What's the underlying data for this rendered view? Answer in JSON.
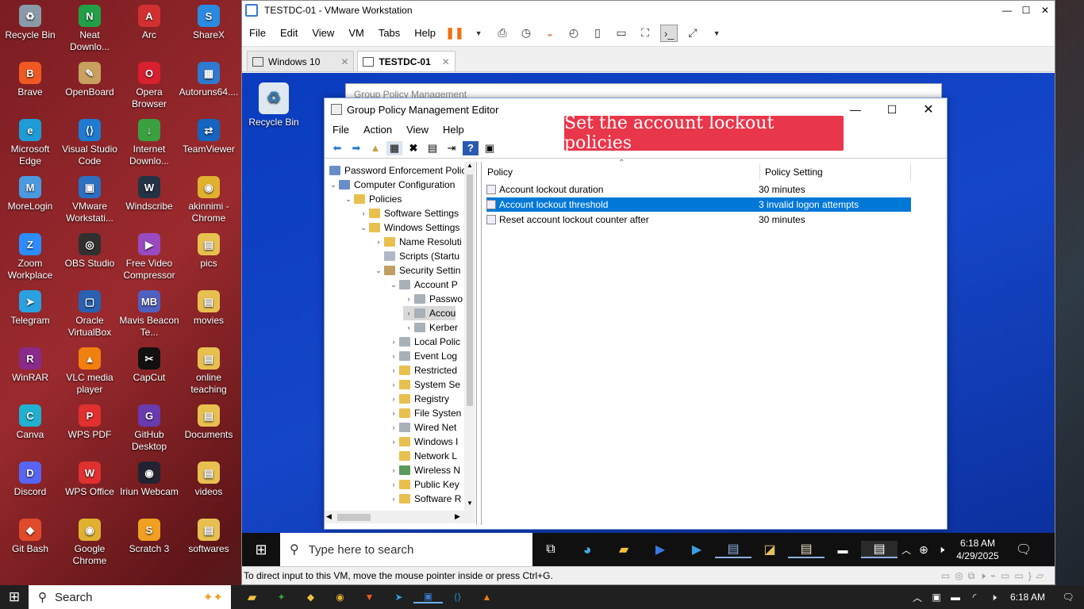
{
  "desktop_icons": [
    {
      "label": "Recycle Bin",
      "color": "#8a9aa8",
      "glyph": "♻"
    },
    {
      "label": "Neat Downlo...",
      "color": "#22a048",
      "glyph": "N"
    },
    {
      "label": "Arc",
      "color": "#d23030",
      "glyph": "A"
    },
    {
      "label": "ShareX",
      "color": "#2a8ae0",
      "glyph": "S"
    },
    {
      "label": "Brave",
      "color": "#f05a22",
      "glyph": "B"
    },
    {
      "label": "OpenBoard",
      "color": "#c8a060",
      "glyph": "✎"
    },
    {
      "label": "Opera Browser",
      "color": "#d8202e",
      "glyph": "O"
    },
    {
      "label": "Autoruns64....",
      "color": "#2f7ad0",
      "glyph": "▦"
    },
    {
      "label": "Microsoft Edge",
      "color": "#1f9bd6",
      "glyph": "e"
    },
    {
      "label": "Visual Studio Code",
      "color": "#1f7bd0",
      "glyph": "⟨⟩"
    },
    {
      "label": "Internet Downlo...",
      "color": "#3aa040",
      "glyph": "↓"
    },
    {
      "label": "TeamViewer",
      "color": "#1565c0",
      "glyph": "⇄"
    },
    {
      "label": "MoreLogin",
      "color": "#4a9ae0",
      "glyph": "M"
    },
    {
      "label": "VMware Workstati...",
      "color": "#2d6fc0",
      "glyph": "▣"
    },
    {
      "label": "Windscribe",
      "color": "#234",
      "glyph": "W"
    },
    {
      "label": "akinnimi - Chrome",
      "color": "#e0b030",
      "glyph": "◉"
    },
    {
      "label": "Zoom Workplace",
      "color": "#2d8cff",
      "glyph": "Z"
    },
    {
      "label": "OBS Studio",
      "color": "#303030",
      "glyph": "◎"
    },
    {
      "label": "Free Video Compressor",
      "color": "#9a4ac0",
      "glyph": "▶"
    },
    {
      "label": "pics",
      "color": "#e8c050",
      "glyph": "▤"
    },
    {
      "label": "Telegram",
      "color": "#2aa0e0",
      "glyph": "➤"
    },
    {
      "label": "Oracle VirtualBox",
      "color": "#2a60b0",
      "glyph": "▢"
    },
    {
      "label": "Mavis Beacon Te...",
      "color": "#5060c0",
      "glyph": "MB"
    },
    {
      "label": "movies",
      "color": "#e8c050",
      "glyph": "▤"
    },
    {
      "label": "WinRAR",
      "color": "#8a2a8a",
      "glyph": "R"
    },
    {
      "label": "VLC media player",
      "color": "#f08010",
      "glyph": "▲"
    },
    {
      "label": "CapCut",
      "color": "#111",
      "glyph": "✂"
    },
    {
      "label": "online teaching",
      "color": "#e8c050",
      "glyph": "▤"
    },
    {
      "label": "Canva",
      "color": "#20b0d0",
      "glyph": "C"
    },
    {
      "label": "WPS PDF",
      "color": "#e03030",
      "glyph": "P"
    },
    {
      "label": "GitHub Desktop",
      "color": "#6a3ab0",
      "glyph": "G"
    },
    {
      "label": "Documents",
      "color": "#e8c050",
      "glyph": "▤"
    },
    {
      "label": "Discord",
      "color": "#5865f2",
      "glyph": "D"
    },
    {
      "label": "WPS Office",
      "color": "#e03030",
      "glyph": "W"
    },
    {
      "label": "Iriun Webcam",
      "color": "#223",
      "glyph": "◉"
    },
    {
      "label": "videos",
      "color": "#e8c050",
      "glyph": "▤"
    },
    {
      "label": "Git Bash",
      "color": "#e04a2a",
      "glyph": "◆"
    },
    {
      "label": "Google Chrome",
      "color": "#e0b030",
      "glyph": "◉"
    },
    {
      "label": "Scratch 3",
      "color": "#f0a020",
      "glyph": "S"
    },
    {
      "label": "softwares",
      "color": "#e8c050",
      "glyph": "▤"
    }
  ],
  "vmware": {
    "title": "TESTDC-01 - VMware Workstation",
    "menu": [
      "File",
      "Edit",
      "View",
      "VM",
      "Tabs",
      "Help"
    ],
    "tabs": [
      {
        "label": "Windows 10"
      },
      {
        "label": "TESTDC-01"
      }
    ],
    "status": "To direct input to this VM, move the mouse pointer inside or press Ctrl+G."
  },
  "guest": {
    "recycle_label": "Recycle Bin",
    "background_window_title": "Group Policy Management",
    "search_placeholder": "Type here to search",
    "clock_time": "6:18 AM",
    "clock_date": "4/29/2025"
  },
  "gpme": {
    "title": "Group Policy Management Editor",
    "menu": [
      "File",
      "Action",
      "View",
      "Help"
    ],
    "tree": [
      {
        "label": "Password Enforcement Polic",
        "indent": 0,
        "arrow": "",
        "icon": "#6a8cc8"
      },
      {
        "label": "Computer Configuration",
        "indent": 1,
        "arrow": "⌄",
        "icon": "#6a8cc8"
      },
      {
        "label": "Policies",
        "indent": 2,
        "arrow": "⌄",
        "icon": "#e8c050"
      },
      {
        "label": "Software Settings",
        "indent": 3,
        "arrow": "›",
        "icon": "#e8c050"
      },
      {
        "label": "Windows Settings",
        "indent": 3,
        "arrow": "⌄",
        "icon": "#e8c050"
      },
      {
        "label": "Name Resoluti",
        "indent": 4,
        "arrow": "›",
        "icon": "#e8c050"
      },
      {
        "label": "Scripts (Startu",
        "indent": 4,
        "arrow": "",
        "icon": "#b0b8c8"
      },
      {
        "label": "Security Settin",
        "indent": 4,
        "arrow": "⌄",
        "icon": "#c0a060"
      },
      {
        "label": "Account P",
        "indent": 5,
        "arrow": "⌄",
        "icon": "#a8b0b8"
      },
      {
        "label": "Passwo",
        "indent": 6,
        "arrow": "›",
        "icon": "#a8b0b8"
      },
      {
        "label": "Accou",
        "indent": 6,
        "arrow": "›",
        "icon": "#a8b0b8",
        "selected": true
      },
      {
        "label": "Kerber",
        "indent": 6,
        "arrow": "›",
        "icon": "#a8b0b8"
      },
      {
        "label": "Local Polic",
        "indent": 5,
        "arrow": "›",
        "icon": "#a8b0b8"
      },
      {
        "label": "Event Log",
        "indent": 5,
        "arrow": "›",
        "icon": "#a8b0b8"
      },
      {
        "label": "Restricted",
        "indent": 5,
        "arrow": "›",
        "icon": "#e8c050"
      },
      {
        "label": "System Se",
        "indent": 5,
        "arrow": "›",
        "icon": "#e8c050"
      },
      {
        "label": "Registry",
        "indent": 5,
        "arrow": "›",
        "icon": "#e8c050"
      },
      {
        "label": "File Systen",
        "indent": 5,
        "arrow": "›",
        "icon": "#e8c050"
      },
      {
        "label": "Wired Net",
        "indent": 5,
        "arrow": "›",
        "icon": "#a8b0b8"
      },
      {
        "label": "Windows I",
        "indent": 5,
        "arrow": "›",
        "icon": "#e8c050"
      },
      {
        "label": "Network L",
        "indent": 5,
        "arrow": "",
        "icon": "#e8c050"
      },
      {
        "label": "Wireless N",
        "indent": 5,
        "arrow": "›",
        "icon": "#5a9a5a"
      },
      {
        "label": "Public Key",
        "indent": 5,
        "arrow": "›",
        "icon": "#e8c050"
      },
      {
        "label": "Software R",
        "indent": 5,
        "arrow": "›",
        "icon": "#e8c050"
      }
    ],
    "columns": {
      "policy": "Policy",
      "setting": "Policy Setting"
    },
    "rows": [
      {
        "policy": "Account lockout duration",
        "setting": "30 minutes"
      },
      {
        "policy": "Account lockout threshold",
        "setting": "3 invalid logon attempts",
        "selected": true
      },
      {
        "policy": "Reset account lockout counter after",
        "setting": "30 minutes"
      }
    ]
  },
  "banner": "Set the account lockout policies",
  "host_taskbar": {
    "search": "Search",
    "time": "6:18 AM"
  }
}
